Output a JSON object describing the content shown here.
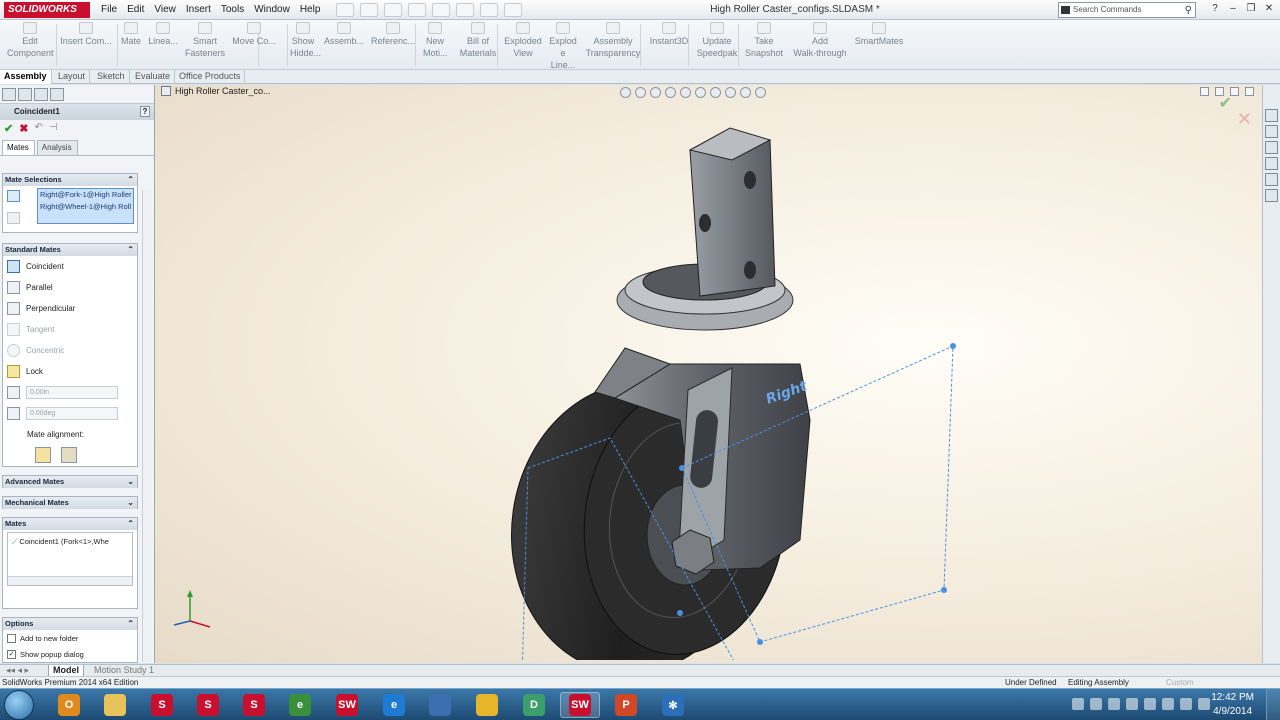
{
  "app": {
    "logo": "SOLIDWORKS",
    "window_title": "High Roller Caster_configs.SLDASM *",
    "search_placeholder": "Search Commands"
  },
  "menu": [
    "File",
    "Edit",
    "View",
    "Insert",
    "Tools",
    "Window",
    "Help"
  ],
  "commands": [
    {
      "line1": "Edit",
      "line2": "Component",
      "icon": "edit-component-icon"
    },
    {
      "line1": "Insert Com...",
      "line2": "",
      "icon": "insert-component-icon"
    },
    {
      "line1": "Mate",
      "line2": "",
      "icon": "mate-icon"
    },
    {
      "line1": "Linea...",
      "line2": "",
      "icon": "linear-pattern-icon"
    },
    {
      "line1": "Smart",
      "line2": "Fasteners",
      "icon": "smart-fasteners-icon"
    },
    {
      "line1": "Move Co...",
      "line2": "",
      "icon": "move-component-icon"
    },
    {
      "line1": "Show",
      "line2": "Hidde...",
      "icon": "show-hidden-icon"
    },
    {
      "line1": "Assemb...",
      "line2": "",
      "icon": "assembly-features-icon"
    },
    {
      "line1": "Referenc...",
      "line2": "",
      "icon": "reference-geometry-icon"
    },
    {
      "line1": "New",
      "line2": "Moti...",
      "icon": "new-motion-study-icon"
    },
    {
      "line1": "Bill of",
      "line2": "Materials",
      "icon": "bom-icon"
    },
    {
      "line1": "Exploded",
      "line2": "View",
      "icon": "exploded-view-icon"
    },
    {
      "line1": "Explod",
      "line2": "e Line...",
      "icon": "explode-line-icon"
    },
    {
      "line1": "Assembly",
      "line2": "Transparency",
      "icon": "transparency-icon"
    },
    {
      "line1": "Instant3D",
      "line2": "",
      "icon": "instant3d-icon"
    },
    {
      "line1": "Update",
      "line2": "Speedpak",
      "icon": "speedpak-icon"
    },
    {
      "line1": "Take",
      "line2": "Snapshot",
      "icon": "snapshot-icon"
    },
    {
      "line1": "Add",
      "line2": "Walk-through",
      "icon": "walkthrough-icon"
    },
    {
      "line1": "SmartMates",
      "line2": "",
      "icon": "smartmates-icon"
    }
  ],
  "tabs": [
    "Assembly",
    "Layout",
    "Sketch",
    "Evaluate",
    "Office Products"
  ],
  "property_manager": {
    "title": "Coincident1",
    "help": "?",
    "subtabs": [
      "Mates",
      "Analysis"
    ],
    "mate_selections": {
      "header": "Mate Selections",
      "items": [
        "Right@Fork-1@High Roller",
        "Right@Wheel-1@High Roll"
      ]
    },
    "standard_mates": {
      "header": "Standard Mates",
      "items": [
        {
          "label": "Coincident",
          "enabled": true,
          "selected": true,
          "icon": "coincident-icon"
        },
        {
          "label": "Parallel",
          "enabled": true,
          "selected": false,
          "icon": "parallel-icon"
        },
        {
          "label": "Perpendicular",
          "enabled": true,
          "selected": false,
          "icon": "perpendicular-icon"
        },
        {
          "label": "Tangent",
          "enabled": false,
          "selected": false,
          "icon": "tangent-icon"
        },
        {
          "label": "Concentric",
          "enabled": false,
          "selected": false,
          "icon": "concentric-icon"
        },
        {
          "label": "Lock",
          "enabled": true,
          "selected": false,
          "icon": "lock-icon"
        }
      ],
      "distance_value": "0.00in",
      "angle_value": "0.00deg",
      "alignment_label": "Mate alignment:"
    },
    "advanced_header": "Advanced Mates",
    "mechanical_header": "Mechanical Mates",
    "mates": {
      "header": "Mates",
      "items": [
        "Coincident1 (Fork<1>,Whe"
      ]
    },
    "options": {
      "header": "Options",
      "items": [
        {
          "label": "Add to new folder",
          "checked": false
        },
        {
          "label": "Show popup dialog",
          "checked": true
        }
      ]
    }
  },
  "viewport": {
    "tree_root": "High Roller Caster_co...",
    "plane_label": "Right"
  },
  "bottom_tabs": [
    "Model",
    "Motion Study 1"
  ],
  "status": {
    "edition": "SolidWorks Premium 2014 x64 Edition",
    "state": "Under Defined",
    "mode": "Editing Assembly",
    "units": "Custom"
  },
  "taskbar": {
    "time": "12:42 PM",
    "date": "4/9/2014",
    "apps": [
      {
        "icon": "outlook-icon",
        "color": "#e08a1e",
        "glyph": "O"
      },
      {
        "icon": "explorer-icon",
        "color": "#e8c25a",
        "glyph": ""
      },
      {
        "icon": "sw-explorer-icon",
        "color": "#c8102e",
        "glyph": "S"
      },
      {
        "icon": "sw-toolbox-icon",
        "color": "#c8102e",
        "glyph": "S"
      },
      {
        "icon": "sw-treehouse-icon",
        "color": "#c8102e",
        "glyph": "S"
      },
      {
        "icon": "edrawings-icon",
        "color": "#3a8f3a",
        "glyph": "e"
      },
      {
        "icon": "solidworks-icon",
        "color": "#c8102e",
        "glyph": "SW"
      },
      {
        "icon": "ie-icon",
        "color": "#1e7ad2",
        "glyph": "e"
      },
      {
        "icon": "sync-icon",
        "color": "#3b6fb0",
        "glyph": ""
      },
      {
        "icon": "chrome-icon",
        "color": "#e6b52a",
        "glyph": ""
      },
      {
        "icon": "dwg-icon",
        "color": "#3b9e6b",
        "glyph": "D"
      },
      {
        "icon": "solidworks-active-icon",
        "color": "#c8102e",
        "glyph": "SW"
      },
      {
        "icon": "powerpoint-icon",
        "color": "#d24726",
        "glyph": "P"
      },
      {
        "icon": "snowflake-app-icon",
        "color": "#2a6fb8",
        "glyph": "✻"
      }
    ]
  },
  "colors": {
    "brand": "#c8102e",
    "selection": "#c9e1fb",
    "ok": "#2e9c2e",
    "cancel": "#c8102e",
    "plane": "#4a90e2"
  }
}
